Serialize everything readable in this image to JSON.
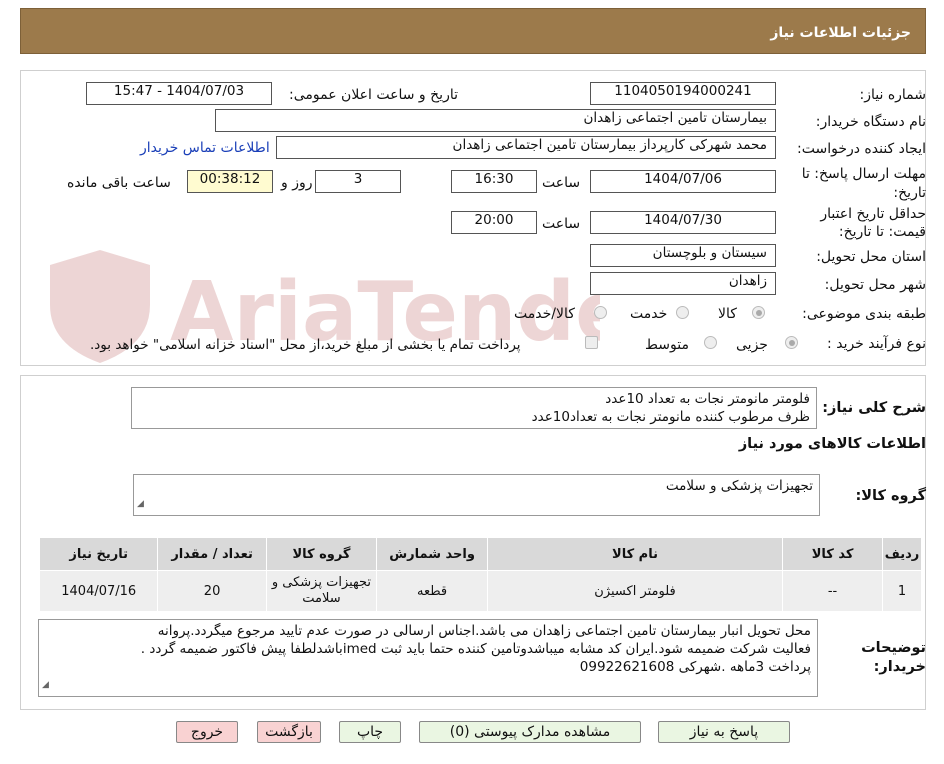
{
  "header": {
    "title": "جزئیات اطلاعات نیاز"
  },
  "form": {
    "need_number_label": "شماره نیاز:",
    "need_number": "1104050194000241",
    "announce_label": "تاریخ و ساعت اعلان عمومی:",
    "announce_value": "1404/07/03 - 15:47",
    "buyer_org_label": "نام دستگاه خریدار:",
    "buyer_org": "بیمارستان تامین اجتماعی زاهدان",
    "requester_label": "ایجاد کننده درخواست:",
    "requester": "محمد شهرکی کارپرداز بیمارستان تامین اجتماعی زاهدان",
    "contact_link": "اطلاعات تماس خریدار",
    "deadline_label_1": "مهلت ارسال پاسخ: تا",
    "deadline_label_2": "تاریخ:",
    "deadline_date": "1404/07/06",
    "time_label": "ساعت",
    "deadline_time": "16:30",
    "days_value": "3",
    "days_label": "روز و",
    "remaining_value": "00:38:12",
    "remaining_label": "ساعت باقی مانده",
    "validity_label_1": "حداقل تاریخ اعتبار",
    "validity_label_2": "قیمت: تا تاریخ:",
    "validity_date": "1404/07/30",
    "validity_time": "20:00",
    "province_label": "استان محل تحویل:",
    "province": "سیستان و بلوچستان",
    "city_label": "شهر محل تحویل:",
    "city": "زاهدان",
    "category_label": "طبقه بندی موضوعی:",
    "category_options": [
      "کالا",
      "خدمت",
      "کالا/خدمت"
    ],
    "process_label": "نوع فرآیند خرید :",
    "process_options": [
      "جزیی",
      "متوسط"
    ],
    "payment_note": "پرداخت تمام یا بخشی از مبلغ خرید،از محل \"اسناد خزانه اسلامی\" خواهد بود."
  },
  "summary": {
    "label": "شرح کلی نیاز:",
    "line1": "فلومتر مانومتر نجات به تعداد 10عدد",
    "line2": "ظرف مرطوب کننده مانومتر نجات به تعداد10عدد"
  },
  "goods": {
    "section_title": "اطلاعات کالاهای مورد نیاز",
    "group_label": "گروه کالا:",
    "group_value": "تجهیزات پزشکی و سلامت"
  },
  "table": {
    "headers": [
      "ردیف",
      "کد کالا",
      "نام کالا",
      "واحد شمارش",
      "گروه کالا",
      "تعداد / مقدار",
      "تاریخ نیاز"
    ],
    "rows": [
      [
        "1",
        "--",
        "فلومتر اکسیژن",
        "قطعه",
        "تجهیزات پزشکی و سلامت",
        "20",
        "1404/07/16"
      ]
    ]
  },
  "buyer_notes": {
    "label_1": "توضیحات",
    "label_2": "خریدار:",
    "line1": "محل تحویل انبار بیمارستان تامین اجتماعی زاهدان می باشد.اجناس ارسالی در صورت عدم تایید مرجوع میگردد.پروانه",
    "line2": "فعالیت شرکت ضمیمه شود.ایران کد مشابه میباشدوتامین کننده حتما باید ثبت imedباشدلطفا پیش فاکتور ضمیمه گردد .",
    "line3": "پرداخت 3ماهه  .شهرکی 09922621608"
  },
  "buttons": {
    "reply": "پاسخ به نیاز",
    "attachments": "مشاهده مدارک پیوستی (0)",
    "print": "چاپ",
    "back": "بازگشت",
    "exit": "خروج"
  },
  "watermark": {
    "text": "AriaTender.neT"
  },
  "colors": {
    "header": "#9c7a4b",
    "remaining_bg": "#fffbd0",
    "link": "#1a3fb8"
  }
}
